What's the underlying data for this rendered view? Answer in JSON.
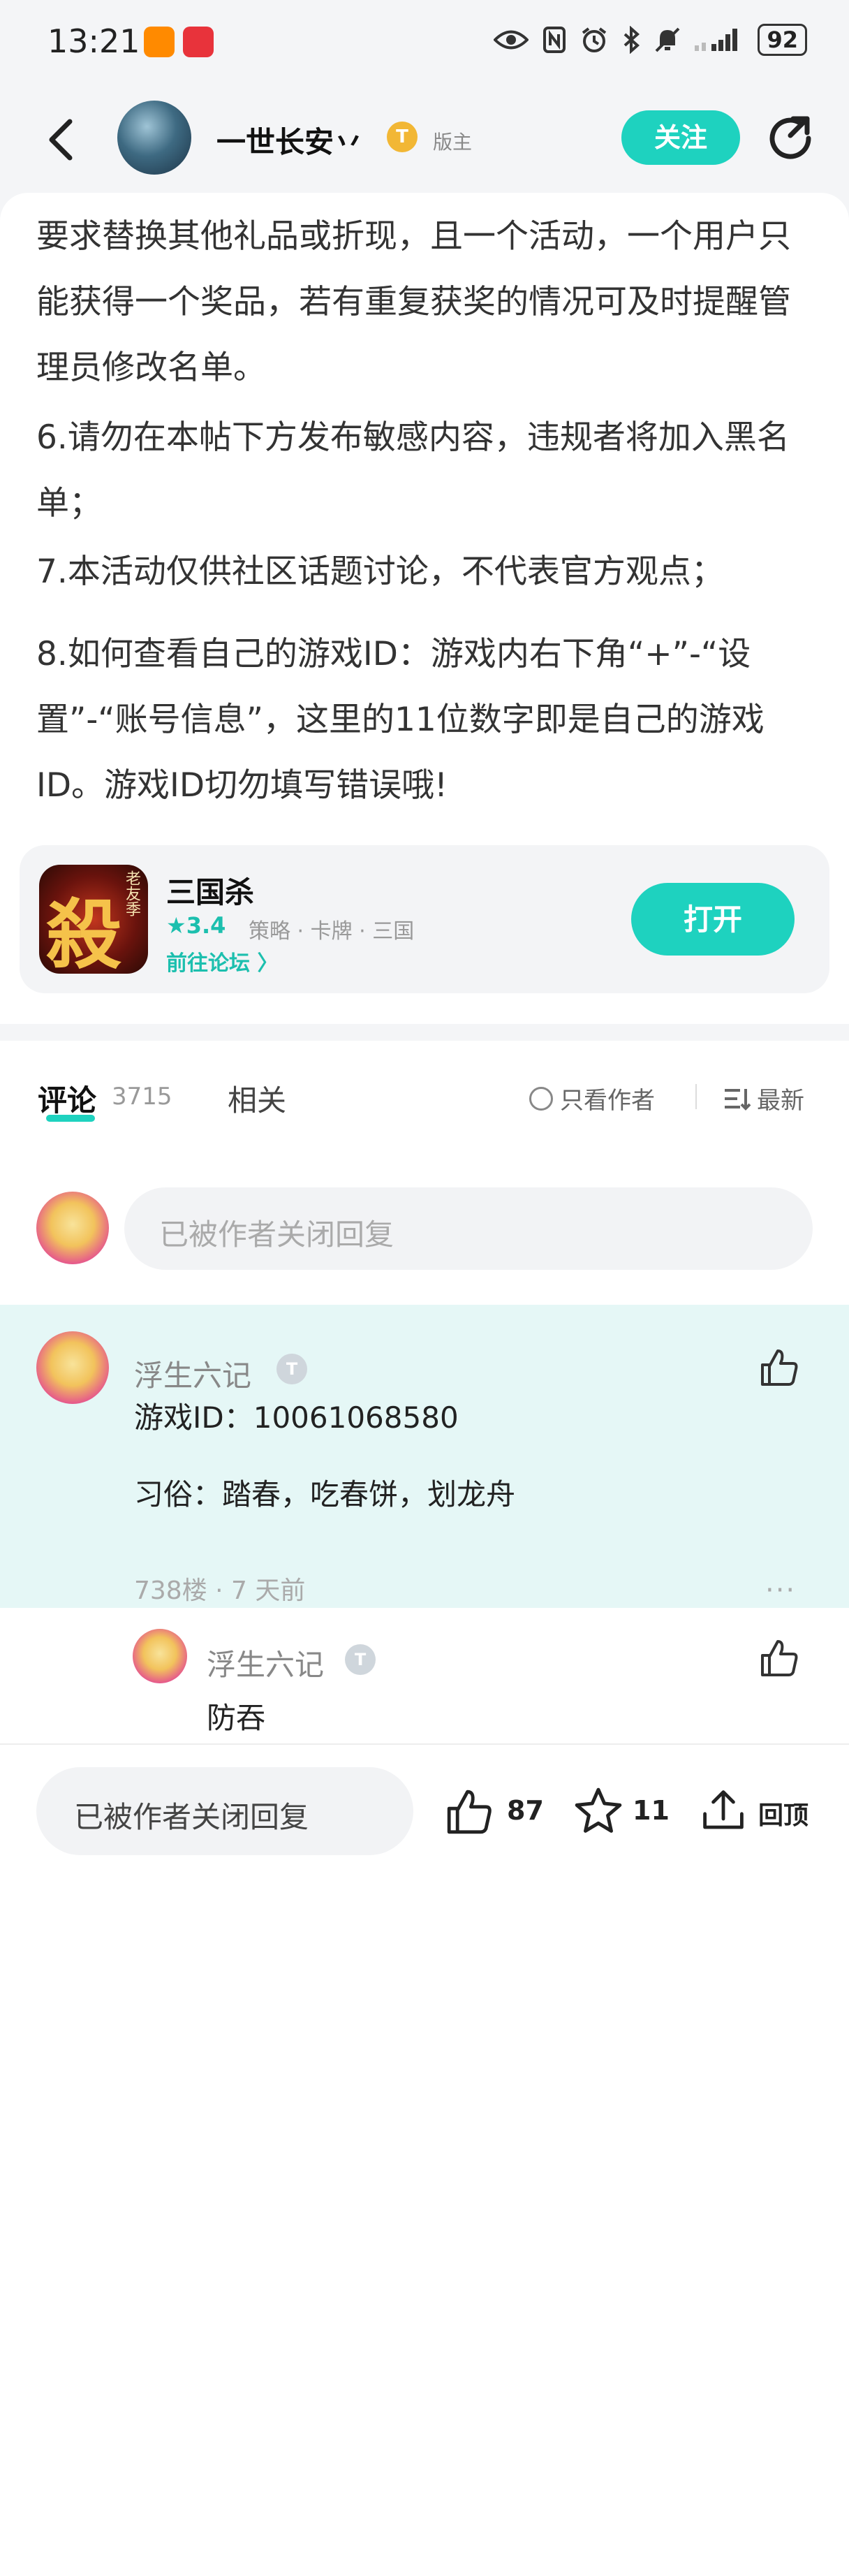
{
  "status_bar": {
    "time": "13:21",
    "battery": "92",
    "icons": [
      "eye-icon",
      "nfc-icon",
      "alarm-icon",
      "bluetooth-icon",
      "mute-icon",
      "signal-icon"
    ],
    "app_badges": [
      "taobao-icon",
      "huawei-icon"
    ]
  },
  "header": {
    "author_name": "一世长安丷",
    "level_badge": "T",
    "role": "版主",
    "follow_label": "关注"
  },
  "post": {
    "paragraphs": [
      "要求替换其他礼品或折现，且一个活动，一个用户只能获得一个奖品，若有重复获奖的情况可及时提醒管理员修改名单。",
      "6.请勿在本帖下方发布敏感内容，违规者将加入黑名单；",
      "7.本活动仅供社区话题讨论，不代表官方观点；",
      "8.如何查看自己的游戏ID：游戏内右下角“+”-“设置”-“账号信息”，这里的11位数字即是自己的游戏ID。游戏ID切勿填写错误哦!"
    ]
  },
  "game_card": {
    "name": "三国杀",
    "icon_glyph": "殺",
    "icon_tag": "老友季",
    "rating": "★3.4",
    "tags": "策略 · 卡牌 · 三国",
    "forum_link": "前往论坛 〉",
    "open_label": "打开"
  },
  "comments_section": {
    "tab_comment": "评论",
    "comment_count": "3715",
    "tab_related": "相关",
    "only_author": "只看作者",
    "latest": "最新",
    "reply_placeholder": "已被作者关闭回复"
  },
  "comment": {
    "user": "浮生六记",
    "level_badge": "T",
    "line1": "游戏ID：10061068580",
    "line2": "习俗：踏春，吃春饼，划龙舟",
    "meta": "738楼 · 7 天前",
    "more": "···"
  },
  "sub_reply": {
    "user": "浮生六记",
    "level_badge": "T",
    "text": "防吞"
  },
  "bottom_bar": {
    "input_placeholder": "已被作者关闭回复",
    "like_count": "87",
    "star_count": "11",
    "top_label": "回顶"
  },
  "colors": {
    "accent": "#1ed2bf",
    "comment_highlight": "#e5f7f6"
  }
}
